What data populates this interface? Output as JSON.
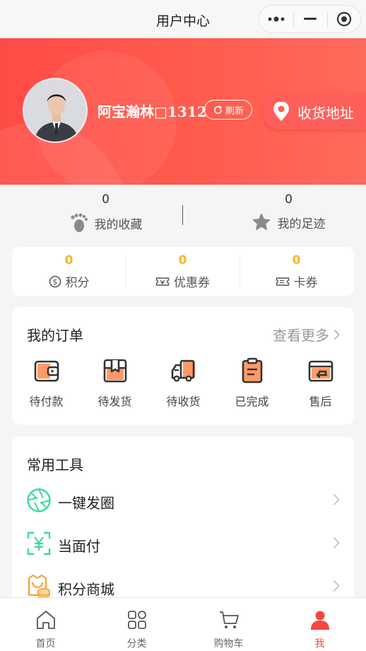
{
  "topbar": {
    "title": "用户中心"
  },
  "profile": {
    "username": "阿宝瀚林□1312",
    "refresh_label": "刷新",
    "address_label": "收货地址"
  },
  "stats": [
    {
      "count": "0",
      "label": "我的收藏",
      "icon": "footprint-icon"
    },
    {
      "count": "0",
      "label": "我的足迹",
      "icon": "star-icon"
    }
  ],
  "points": [
    {
      "value": "0",
      "label": "积分",
      "icon": "coin-icon"
    },
    {
      "value": "0",
      "label": "优惠券",
      "icon": "coupon-icon"
    },
    {
      "value": "0",
      "label": "卡券",
      "icon": "ticket-icon"
    }
  ],
  "orders": {
    "title": "我的订单",
    "more_label": "查看更多",
    "items": [
      {
        "label": "待付款",
        "icon": "wallet-icon"
      },
      {
        "label": "待发货",
        "icon": "package-icon"
      },
      {
        "label": "待收货",
        "icon": "truck-icon"
      },
      {
        "label": "已完成",
        "icon": "clipboard-icon"
      },
      {
        "label": "售后",
        "icon": "card-return-icon"
      }
    ]
  },
  "tools": {
    "title": "常用工具",
    "items": [
      {
        "label": "一键发圈",
        "icon": "aperture-icon"
      },
      {
        "label": "当面付",
        "icon": "scan-yen-icon"
      },
      {
        "label": "积分商城",
        "icon": "shop-coins-icon"
      }
    ]
  },
  "tabbar": [
    {
      "label": "首页",
      "icon": "home-icon",
      "active": false
    },
    {
      "label": "分类",
      "icon": "category-icon",
      "active": false
    },
    {
      "label": "购物车",
      "icon": "cart-icon",
      "active": false
    },
    {
      "label": "我",
      "icon": "user-icon",
      "active": true
    }
  ],
  "colors": {
    "brand_red": "#ff4b45",
    "accent_orange": "#f7b533",
    "icon_orange": "#ff9a66",
    "tool_green": "#3fd89a",
    "active_tab": "#f2473f"
  }
}
